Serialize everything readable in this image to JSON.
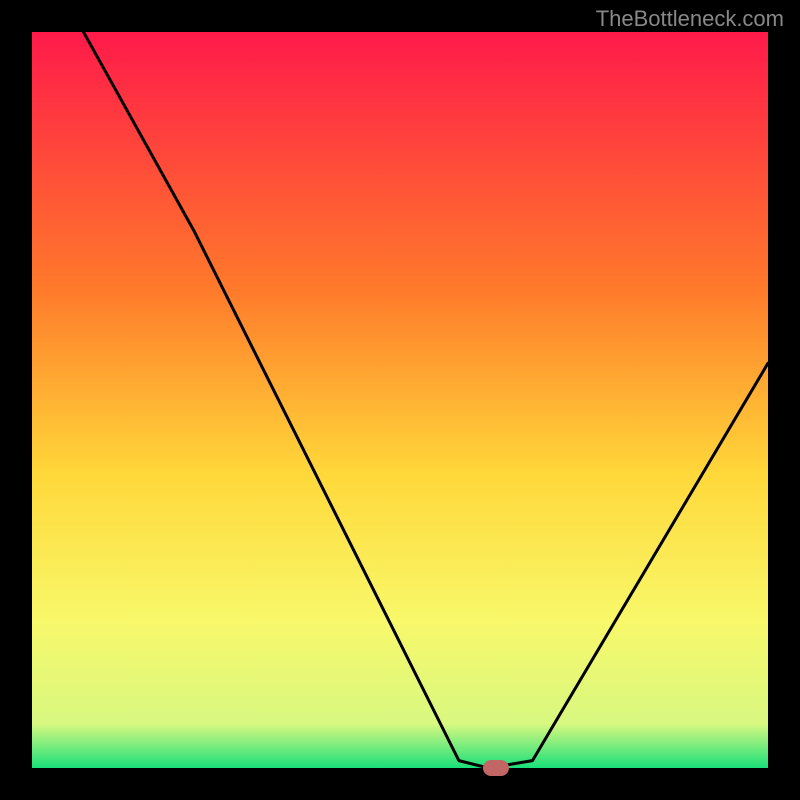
{
  "watermark": "TheBottleneck.com",
  "chart_data": {
    "type": "line",
    "title": "",
    "xlabel": "",
    "ylabel": "",
    "xlim": [
      0,
      100
    ],
    "ylim": [
      0,
      100
    ],
    "x": [
      7,
      22,
      58,
      62,
      68,
      100
    ],
    "values": [
      100,
      73,
      1,
      0,
      1,
      55
    ],
    "gradient_stops": [
      {
        "pos": 0,
        "color": "#ff1a4a"
      },
      {
        "pos": 35,
        "color": "#ff7a2a"
      },
      {
        "pos": 60,
        "color": "#ffd83a"
      },
      {
        "pos": 80,
        "color": "#f8f86a"
      },
      {
        "pos": 94,
        "color": "#d8f880"
      },
      {
        "pos": 100,
        "color": "#1ae07a"
      }
    ],
    "marker": {
      "x": 63,
      "y": 0,
      "color": "#c26565"
    }
  }
}
